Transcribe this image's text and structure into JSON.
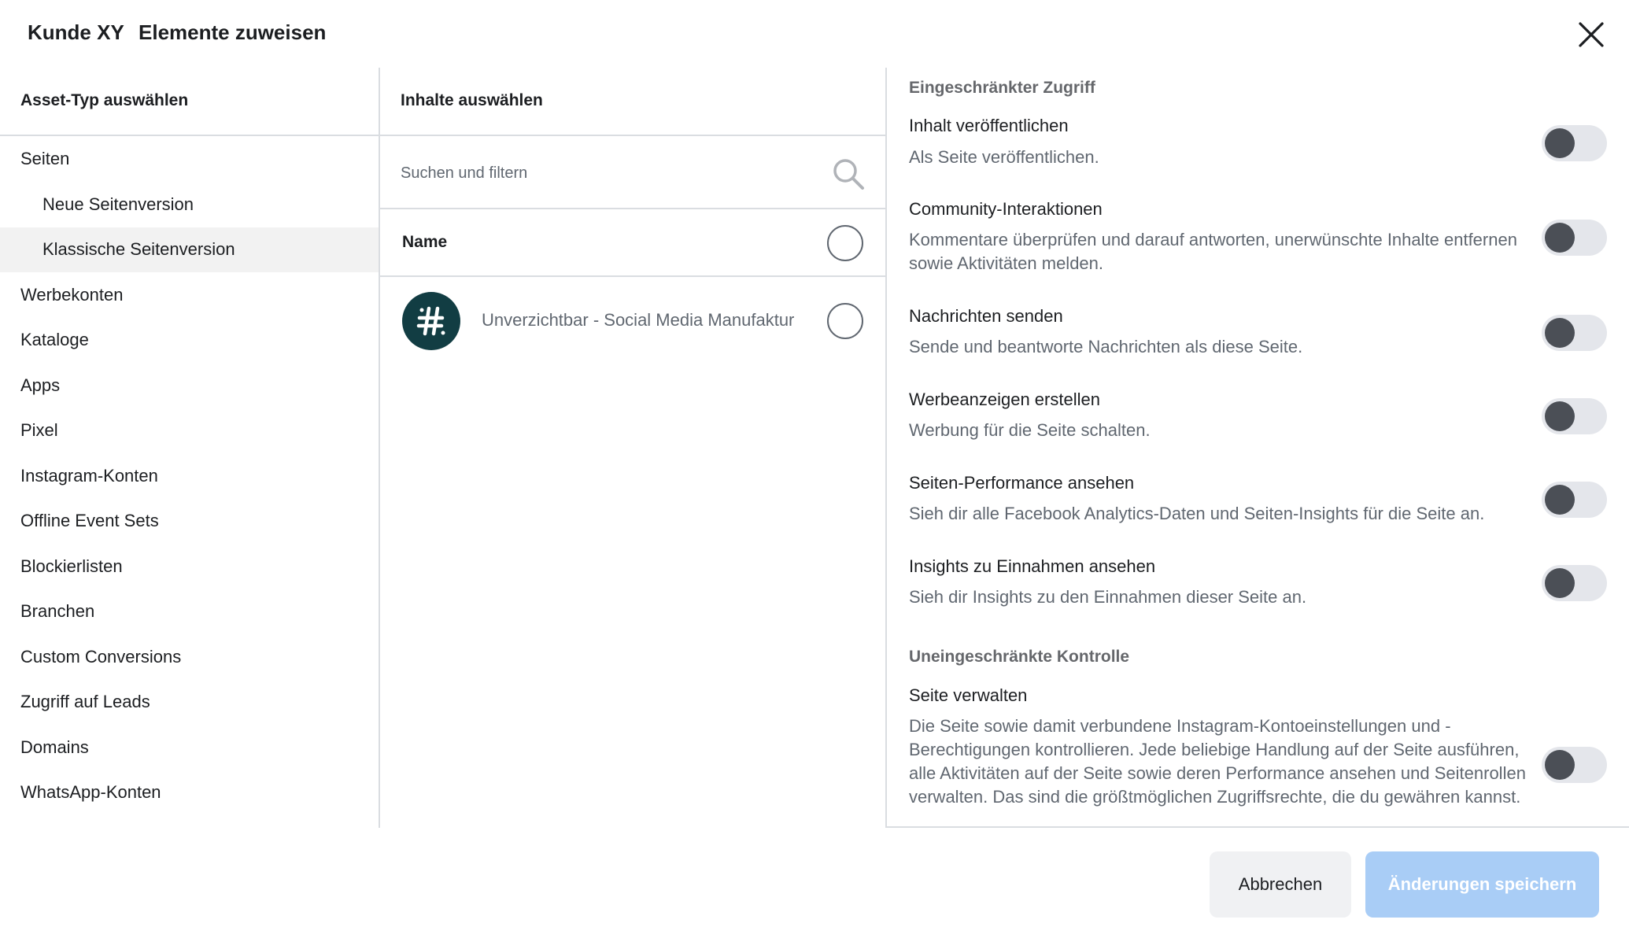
{
  "header": {
    "client_name": "Kunde XY",
    "title": "Elemente zuweisen",
    "close_icon": "close-icon"
  },
  "left_panel": {
    "heading": "Asset-Typ auswählen",
    "items": [
      {
        "label": "Seiten"
      },
      {
        "label": "Neue Seitenversion"
      },
      {
        "label": "Klassische Seitenversion"
      },
      {
        "label": "Werbekonten"
      },
      {
        "label": "Kataloge"
      },
      {
        "label": "Apps"
      },
      {
        "label": "Pixel"
      },
      {
        "label": "Instagram-Konten"
      },
      {
        "label": "Offline Event Sets"
      },
      {
        "label": "Blockierlisten"
      },
      {
        "label": "Branchen"
      },
      {
        "label": "Custom Conversions"
      },
      {
        "label": "Zugriff auf Leads"
      },
      {
        "label": "Domains"
      },
      {
        "label": "WhatsApp-Konten"
      }
    ]
  },
  "middle_panel": {
    "heading": "Inhalte auswählen",
    "search_placeholder": "Suchen und filtern",
    "search_icon": "search-icon",
    "column_header": "Name",
    "assets": [
      {
        "name": "Unverzichtbar - Social Media Manufaktur",
        "avatar_color": "#123d43"
      }
    ]
  },
  "right_panel": {
    "section_restricted": "Eingeschränkter Zugriff",
    "permissions": [
      {
        "title": "Inhalt veröffentlichen",
        "desc": "Als Seite veröffentlichen."
      },
      {
        "title": "Community-Interaktionen",
        "desc": "Kommentare überprüfen und darauf antworten, unerwünschte Inhalte entfernen sowie Aktivitäten melden."
      },
      {
        "title": "Nachrichten senden",
        "desc": "Sende und beantworte Nachrichten als diese Seite."
      },
      {
        "title": "Werbeanzeigen erstellen",
        "desc": "Werbung für die Seite schalten."
      },
      {
        "title": "Seiten-Performance ansehen",
        "desc": "Sieh dir alle Facebook Analytics-Daten und Seiten-Insights für die Seite an."
      },
      {
        "title": "Insights zu Einnahmen ansehen",
        "desc": "Sieh dir Insights zu den Einnahmen dieser Seite an."
      }
    ],
    "section_full": "Uneingeschränkte Kontrolle",
    "full_permission": {
      "title": "Seite verwalten",
      "desc": "Die Seite sowie damit verbundene Instagram-Kontoeinstellungen und -Berechtigungen kontrollieren. Jede beliebige Handlung auf der Seite ausführen, alle Aktivitäten auf der Seite sowie deren Performance ansehen und Seitenrollen verwalten. Das sind die größtmöglichen Zugriffsrechte, die du gewähren kannst."
    }
  },
  "footer": {
    "cancel_label": "Abbrechen",
    "save_label": "Änderungen speichern"
  },
  "colors": {
    "save_button_disabled": "#a9cdf6",
    "selected_row": "#f2f2f2",
    "toggle_knob": "#4b4f56"
  }
}
